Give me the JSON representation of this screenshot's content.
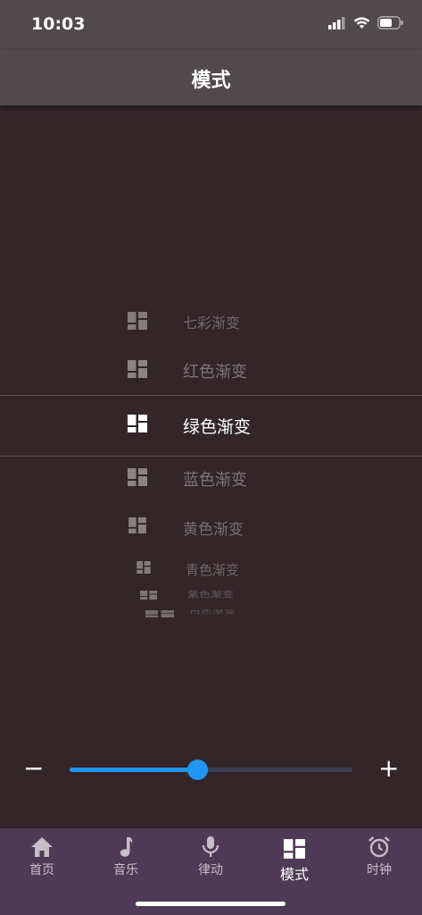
{
  "status": {
    "time": "10:03"
  },
  "header": {
    "title": "模式"
  },
  "picker": {
    "items": [
      {
        "label": "七彩渐变",
        "opacity": 0.55
      },
      {
        "label": "红色渐变",
        "opacity": 0.6
      },
      {
        "label": "绿色渐变",
        "opacity": 1.0
      },
      {
        "label": "蓝色渐变",
        "opacity": 0.6
      },
      {
        "label": "黄色渐变",
        "opacity": 0.58
      },
      {
        "label": "青色渐变",
        "opacity": 0.55
      },
      {
        "label": "紫色渐变",
        "opacity": 0.5
      },
      {
        "label": "白色渐变",
        "opacity": 0.45
      }
    ],
    "selected_index": 2
  },
  "slider": {
    "minus_label": "−",
    "plus_label": "+",
    "value": 0.45
  },
  "tabs": [
    {
      "label": "首页",
      "icon": "home-icon"
    },
    {
      "label": "音乐",
      "icon": "music-note-icon"
    },
    {
      "label": "律动",
      "icon": "microphone-icon"
    },
    {
      "label": "模式",
      "icon": "dashboard-icon",
      "active": true
    },
    {
      "label": "时钟",
      "icon": "alarm-clock-icon"
    }
  ],
  "colors": {
    "accent": "#2196f3",
    "background": "#332528",
    "tabbar": "#4f3a55",
    "header": "#514a4c"
  }
}
